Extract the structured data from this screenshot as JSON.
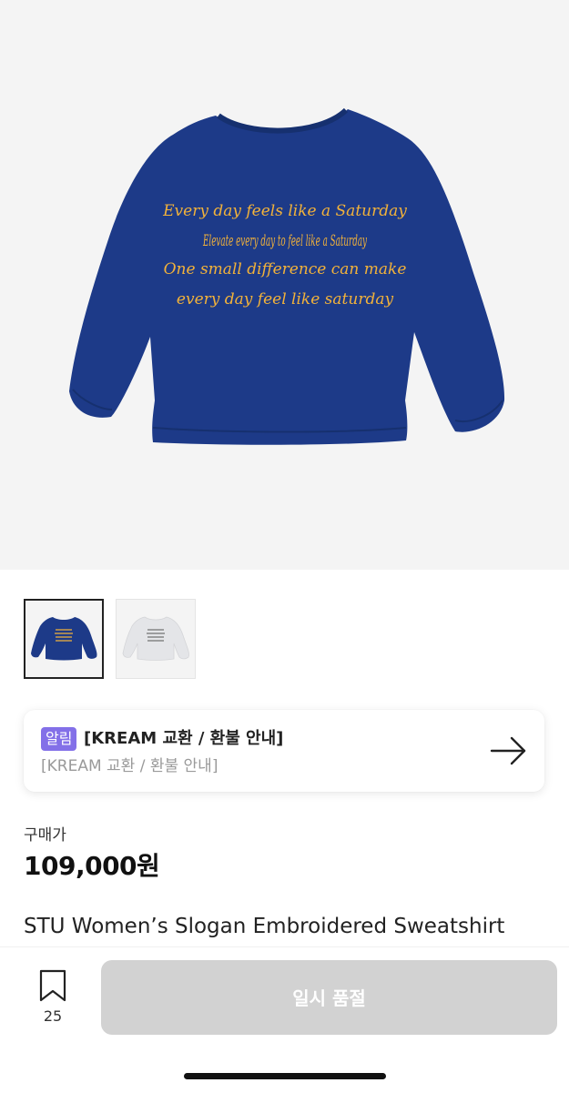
{
  "product": {
    "main_image": {
      "garment_color": "#1d3a88",
      "embroidery_color": "#f2b23a",
      "embroidery_lines": [
        "Every day feels like a Saturday",
        "Elevate every day to feel like a Saturday",
        "One small difference can make",
        "every day feel like saturday"
      ]
    },
    "thumbnails": [
      {
        "color": "#1d3a88",
        "selected": true
      },
      {
        "color": "#e6e6e8",
        "selected": false
      }
    ],
    "name": "STU Women’s Slogan Embroidered Sweatshirt"
  },
  "notice": {
    "badge": "알림",
    "title": "[KREAM 교환 / 환불 안내]",
    "subtitle": "[KREAM 교환 / 환불 안내]",
    "icon": "arrow-right-icon"
  },
  "price": {
    "label": "구매가",
    "value": "109,000원"
  },
  "bottom_bar": {
    "bookmark_icon": "bookmark-icon",
    "bookmark_count": "25",
    "action_label": "일시 품절"
  },
  "colors": {
    "badge": "#8370e8",
    "disabled_button": "#d2d2d2"
  }
}
